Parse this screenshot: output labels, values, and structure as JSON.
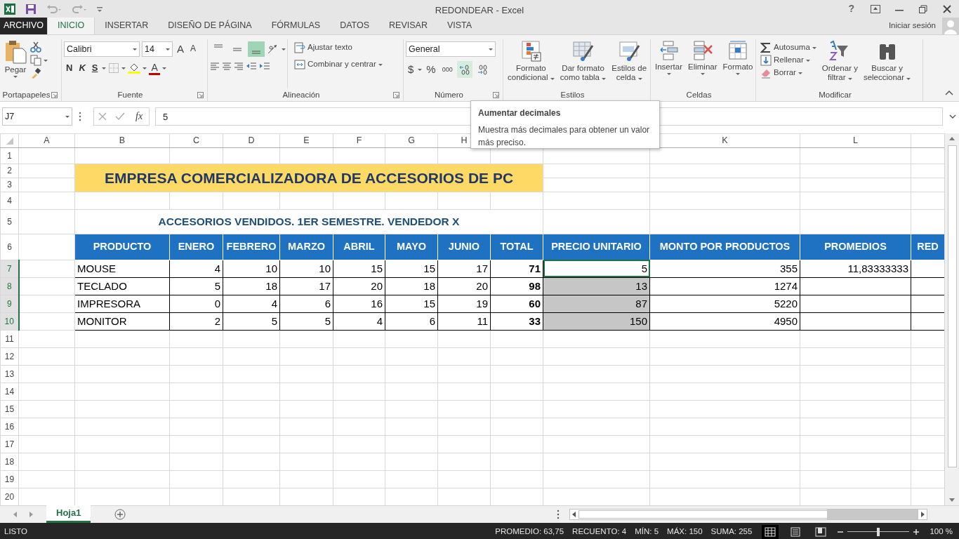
{
  "window": {
    "title": "REDONDEAR - Excel",
    "help": "?"
  },
  "account": {
    "label": "Iniciar sesión"
  },
  "tabs": [
    {
      "label": "ARCHIVO",
      "kind": "file",
      "selected": false
    },
    {
      "label": "INICIO",
      "kind": "tab",
      "selected": true
    },
    {
      "label": "INSERTAR",
      "kind": "tab",
      "selected": false
    },
    {
      "label": "DISEÑO DE PÁGINA",
      "kind": "tab",
      "selected": false
    },
    {
      "label": "FÓRMULAS",
      "kind": "tab",
      "selected": false
    },
    {
      "label": "DATOS",
      "kind": "tab",
      "selected": false
    },
    {
      "label": "REVISAR",
      "kind": "tab",
      "selected": false
    },
    {
      "label": "VISTA",
      "kind": "tab",
      "selected": false
    }
  ],
  "ribbon": {
    "groups": [
      {
        "kind": "clipboard",
        "label": "Portapapeles",
        "paste": "Pegar"
      },
      {
        "kind": "font",
        "label": "Fuente",
        "font": "Calibri",
        "size": "14",
        "size_buttons": [
          "A",
          "A"
        ],
        "styles": [
          "N",
          "K",
          "S"
        ],
        "font_color": "A"
      },
      {
        "kind": "alignment",
        "label": "Alineación",
        "vertical": [
          {
            "selected": false
          },
          {
            "selected": false
          },
          {
            "selected": true
          }
        ],
        "wrap": "Ajustar texto",
        "merge": "Combinar y centrar"
      },
      {
        "kind": "number",
        "label": "Número",
        "format": "General",
        "symbols": [
          "$",
          "%",
          "000"
        ],
        "decimals": [
          {
            "hovered": true
          },
          {
            "hovered": false
          }
        ]
      },
      {
        "kind": "styles",
        "label": "Estilos",
        "buttons": [
          {
            "lines": [
              "Formato",
              "condicional"
            ]
          },
          {
            "lines": [
              "Dar formato",
              "como tabla"
            ]
          },
          {
            "lines": [
              "Estilos de",
              "celda"
            ]
          }
        ]
      },
      {
        "kind": "cells",
        "label": "Celdas",
        "buttons": [
          "Insertar",
          "Eliminar",
          "Formato"
        ]
      },
      {
        "kind": "editing",
        "label": "Modificar",
        "small": [
          "Autosuma",
          "Rellenar",
          "Borrar"
        ],
        "buttons": [
          {
            "lines": [
              "Ordenar y",
              "filtrar"
            ]
          },
          {
            "lines": [
              "Buscar y",
              "seleccionar"
            ]
          }
        ]
      }
    ]
  },
  "name_box": "J7",
  "function_symbol": "fx",
  "formula": "5",
  "tooltip": {
    "title": "Aumentar decimales",
    "text": "Muestra más decimales para obtener un valor más preciso."
  },
  "sheet": {
    "columns": [
      {
        "label": "A"
      },
      {
        "label": "B"
      },
      {
        "label": "C"
      },
      {
        "label": "D"
      },
      {
        "label": "E"
      },
      {
        "label": "F"
      },
      {
        "label": "G"
      },
      {
        "label": "H"
      },
      {},
      {},
      {
        "label": "K"
      },
      {
        "label": "L"
      },
      {}
    ],
    "rows": [
      "1",
      "2",
      "3",
      "4",
      "5",
      "6",
      "7",
      "8",
      "9",
      "10",
      "11",
      "12",
      "13",
      "14",
      "15",
      "16",
      "17",
      "18",
      "19",
      "20"
    ],
    "title": "EMPRESA COMERCIALIZADORA DE ACCESORIOS DE PC",
    "subtitle": "ACCESORIOS VENDIDOS. 1ER SEMESTRE. VENDEDOR X",
    "header": [
      "PRODUCTO",
      "ENERO",
      "FEBRERO",
      "MARZO",
      "ABRIL",
      "MAYO",
      "JUNIO",
      "TOTAL",
      "PRECIO UNITARIO",
      "MONTO POR PRODUCTOS",
      "PROMEDIOS",
      "RED"
    ],
    "data": [
      {
        "product": "MOUSE",
        "values": [
          "4",
          "10",
          "10",
          "15",
          "15",
          "17"
        ],
        "total": "71",
        "price": {
          "value": "5",
          "selected": true,
          "active": true
        },
        "amount": "355",
        "average": "11,83333333"
      },
      {
        "product": "TECLADO",
        "values": [
          "5",
          "18",
          "17",
          "20",
          "18",
          "20"
        ],
        "total": "98",
        "price": {
          "value": "13",
          "selected": true,
          "active": false
        },
        "amount": "1274"
      },
      {
        "product": "IMPRESORA",
        "values": [
          "0",
          "4",
          "6",
          "16",
          "15",
          "19"
        ],
        "total": "60",
        "price": {
          "value": "87",
          "selected": true,
          "active": false
        },
        "amount": "5220"
      },
      {
        "product": "MONITOR",
        "values": [
          "2",
          "5",
          "5",
          "4",
          "6",
          "11"
        ],
        "total": "33",
        "price": {
          "value": "150",
          "selected": true,
          "active": false
        },
        "amount": "4950"
      }
    ]
  },
  "sheet_tabs": [
    {
      "label": "Hoja1",
      "selected": true
    }
  ],
  "status": {
    "mode": "LISTO",
    "stats": [
      "PROMEDIO: 63,75",
      "RECUENTO: 4",
      "MÍN: 5",
      "MÁX: 150",
      "SUMA: 255"
    ],
    "views": [
      {
        "selected": true
      },
      {
        "selected": false
      },
      {
        "selected": false
      }
    ],
    "zoom": {
      "level": 0.5,
      "label": "100 %"
    }
  }
}
